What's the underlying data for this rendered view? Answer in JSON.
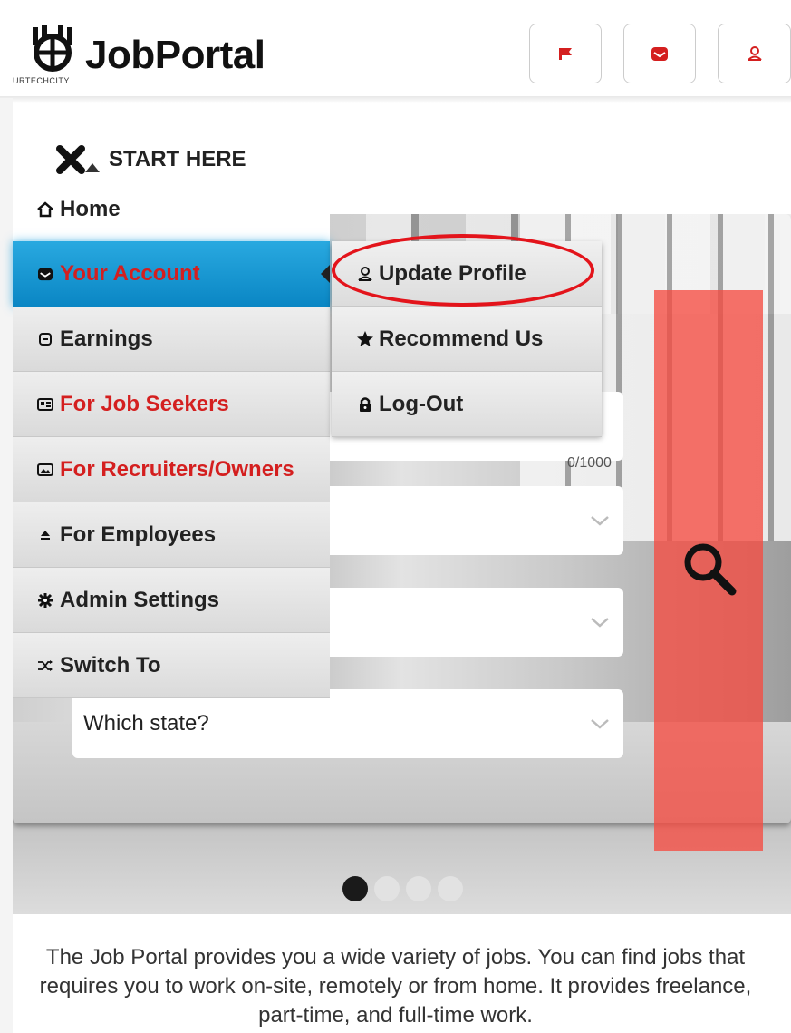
{
  "header": {
    "brand": "JobPortal",
    "brand_sub": "URTECHCITY",
    "buttons": [
      {
        "name": "flag-button",
        "icon": "flag-icon"
      },
      {
        "name": "account-button",
        "icon": "account-icon"
      },
      {
        "name": "profile-button",
        "icon": "user-icon"
      }
    ]
  },
  "start": {
    "label": "START HERE",
    "icon": "close-icon"
  },
  "menu": {
    "items": [
      {
        "label": "Home",
        "icon": "home-icon"
      },
      {
        "label": "Your Account",
        "icon": "account-icon",
        "active": true
      },
      {
        "label": "Earnings",
        "icon": "earnings-icon"
      },
      {
        "label": "For Job Seekers",
        "icon": "id-card-icon",
        "color": "#d41f1f"
      },
      {
        "label": "For Recruiters/Owners",
        "icon": "image-icon",
        "color": "#d41f1f"
      },
      {
        "label": "For Employees",
        "icon": "eject-icon"
      },
      {
        "label": "Admin Settings",
        "icon": "gear-icon"
      },
      {
        "label": "Switch To",
        "icon": "shuffle-icon"
      }
    ]
  },
  "submenu": {
    "items": [
      {
        "label": "Update Profile",
        "icon": "user-icon"
      },
      {
        "label": "Recommend Us",
        "icon": "star-icon"
      },
      {
        "label": "Log-Out",
        "icon": "lock-icon"
      }
    ]
  },
  "search": {
    "counter": "0/1000",
    "state_placeholder": "Which state?"
  },
  "carousel": {
    "count": 4,
    "active": 0
  },
  "description": "The Job Portal provides you a wide variety of jobs. You can find jobs that requires you to work on-site, remotely or from home. It provides freelance, part-time, and full-time work.",
  "colors": {
    "accent_red": "#d41f1f",
    "active_blue": "#0a86c4",
    "search_panel": "#f54b41"
  }
}
